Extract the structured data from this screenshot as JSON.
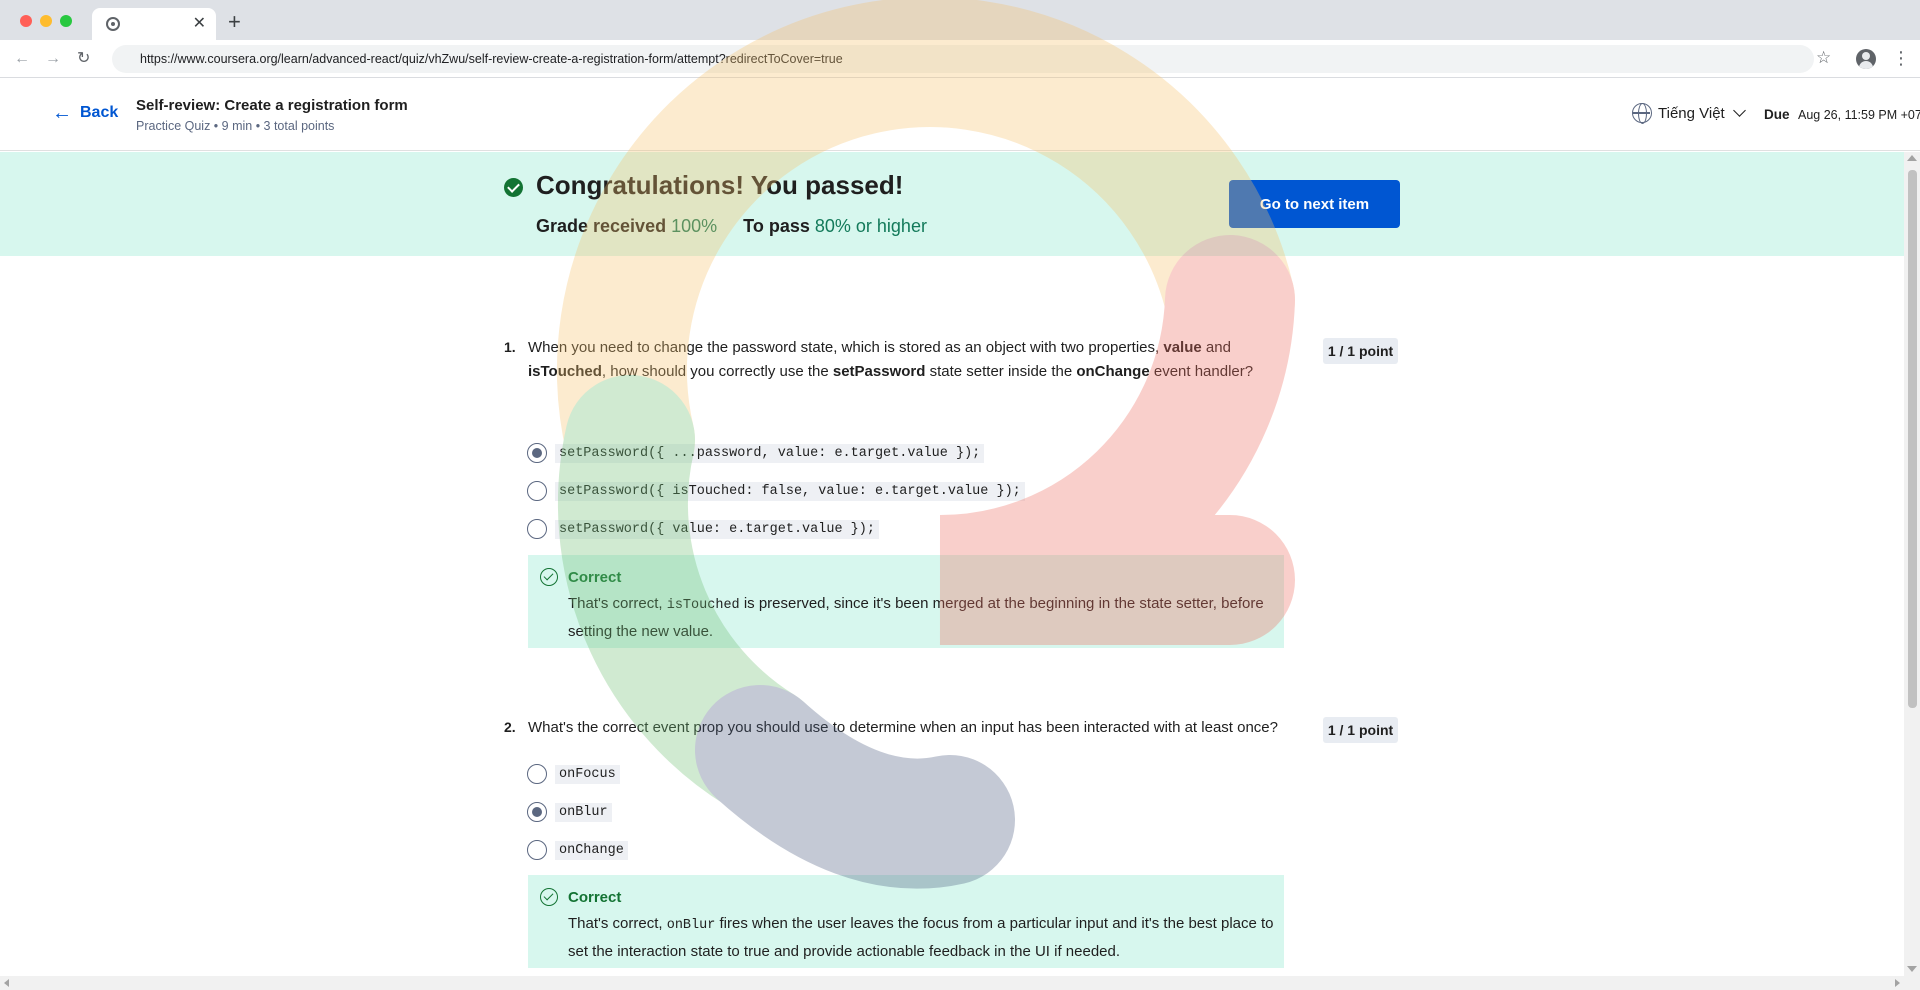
{
  "browser": {
    "tab_close": "✕",
    "new_tab": "+",
    "url": "https://www.coursera.org/learn/advanced-react/quiz/vhZwu/self-review-create-a-registration-form/attempt?redirectToCover=true",
    "icons": {
      "back": "arrow-left-icon",
      "forward": "arrow-right-icon",
      "reload": "reload-icon",
      "bookmark": "star-icon",
      "profile": "profile-icon",
      "menu": "kebab-menu-icon"
    }
  },
  "header": {
    "back_label": "Back",
    "title": "Self-review: Create a registration form",
    "meta": "Practice Quiz • 9 min • 3 total points",
    "language": "Tiếng Việt",
    "due_label": "Due",
    "due_value": "Aug 26, 11:59 PM +07"
  },
  "banner": {
    "title": "Congratulations! You passed!",
    "grade_label": "Grade received",
    "grade_value": "100%",
    "pass_label": "To pass",
    "pass_value": "80% or higher",
    "next_button": "Go to next item",
    "accent_color": "#0056d2",
    "background_color": "#d7f7ee"
  },
  "questions": [
    {
      "number": "1.",
      "text_parts": [
        "When you need to change the password state, which is stored as an object with two properties, ",
        "value",
        " and ",
        "isTouched",
        ", how should you correctly use the ",
        "setPassword",
        " state setter inside the ",
        "onChange",
        " event handler?"
      ],
      "points": "1 / 1 point",
      "options": [
        {
          "code": "setPassword({ ...password, value: e.target.value });",
          "selected": true
        },
        {
          "code": "setPassword({ isTouched: false, value: e.target.value });",
          "selected": false
        },
        {
          "code": "setPassword({ value: e.target.value });",
          "selected": false
        }
      ],
      "feedback": {
        "title": "Correct",
        "pre": "That's correct, ",
        "code": "isTouched",
        "post": " is preserved, since it's been merged at the beginning in the state setter, before setting the new value."
      }
    },
    {
      "number": "2.",
      "text": "What's the correct event prop you should use to determine when an input has been interacted with at least once?",
      "points": "1 / 1 point",
      "options": [
        {
          "code": "onFocus",
          "selected": false
        },
        {
          "code": "onBlur",
          "selected": true
        },
        {
          "code": "onChange",
          "selected": false
        }
      ],
      "feedback": {
        "title": "Correct",
        "pre": "That's correct, ",
        "code": "onBlur",
        "post": " fires when the user leaves the focus from a particular input and it's the best place to set the interaction state to true and provide actionable feedback in the UI if needed."
      }
    }
  ],
  "watermark": {
    "colors": [
      "#f6c26b",
      "#ef6d5f",
      "#6fbf73",
      "#4a5a7e"
    ]
  }
}
